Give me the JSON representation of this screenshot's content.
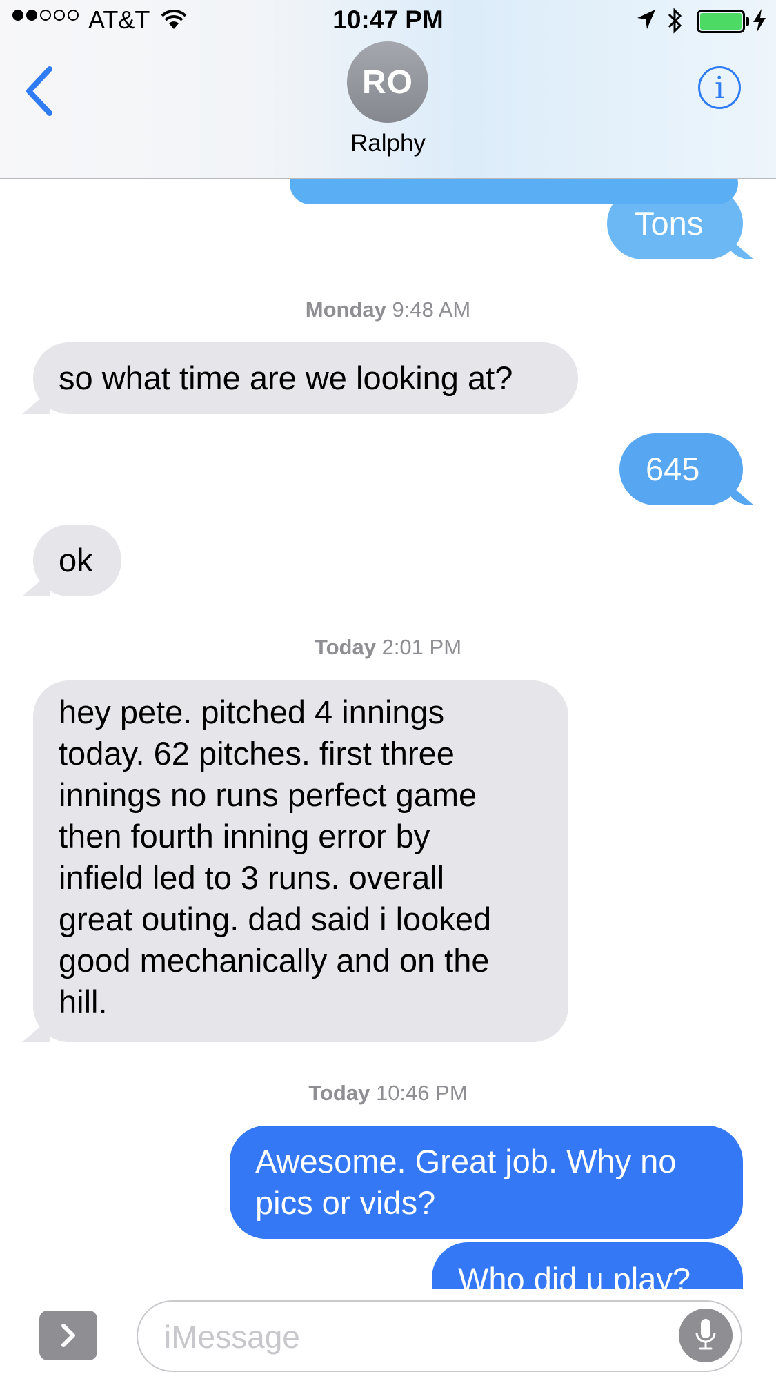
{
  "status_bar": {
    "carrier": "AT&T",
    "time": "10:47 PM",
    "signal_bars_filled": 2,
    "signal_bars_total": 5,
    "battery_level": 1.0,
    "battery_color": "#4cd964",
    "icons": [
      "wifi-icon",
      "location-arrow-icon",
      "bluetooth-icon",
      "battery-icon",
      "charging-bolt-icon"
    ]
  },
  "header": {
    "avatar_initials": "RO",
    "contact_name": "Ralphy",
    "back_icon": "chevron-left-icon",
    "info_icon": "info-icon",
    "info_glyph": "i",
    "accent_color": "#2f7cf6"
  },
  "messages": [
    {
      "type": "sent",
      "text": "Tons"
    },
    {
      "type": "timestamp",
      "day": "Monday",
      "time": "9:48 AM"
    },
    {
      "type": "received",
      "text": "so what time are we looking at?"
    },
    {
      "type": "sent",
      "text": "645"
    },
    {
      "type": "received",
      "text": "ok"
    },
    {
      "type": "timestamp",
      "day": "Today",
      "time": "2:01 PM"
    },
    {
      "type": "received",
      "lines": [
        "hey pete. pitched 4 innings",
        "today. 62 pitches. first three",
        "innings no runs perfect game",
        "then fourth inning error by",
        "infield led to 3 runs. overall",
        "great outing. dad said i looked",
        "good mechanically and on the",
        "hill."
      ]
    },
    {
      "type": "timestamp",
      "day": "Today",
      "time": "10:46 PM"
    },
    {
      "type": "sent",
      "lines": [
        "Awesome. Great job. Why no",
        "pics or vids?"
      ]
    },
    {
      "type": "sent",
      "text": "Who did u play?"
    }
  ],
  "input_bar": {
    "placeholder": "iMessage",
    "apps_icon": "chevron-right-icon",
    "mic_icon": "microphone-icon"
  }
}
